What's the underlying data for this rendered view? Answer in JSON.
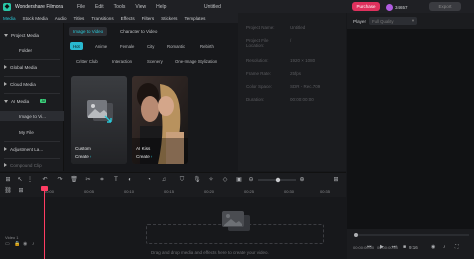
{
  "titlebar": {
    "app_name": "Wondershare Filmora",
    "menu": [
      "File",
      "Edit",
      "Tools",
      "View",
      "Help"
    ],
    "doc_title": "Untitled",
    "purchase_label": "Purchase",
    "coins": "34657",
    "export_label": "Export"
  },
  "toolbar": {
    "tabs": [
      "Media",
      "Stock Media",
      "Audio",
      "Titles",
      "Transitions",
      "Effects",
      "Filters",
      "Stickers",
      "Templates"
    ],
    "active_tab": "Media"
  },
  "sidebar": {
    "items": [
      {
        "label": "Project Media",
        "type": "group",
        "expanded": true
      },
      {
        "label": "Folder",
        "type": "sub"
      },
      {
        "label": "Global Media",
        "type": "group",
        "expanded": false
      },
      {
        "label": "Cloud Media",
        "type": "group",
        "expanded": false
      },
      {
        "label": "AI Media",
        "type": "group",
        "expanded": true,
        "badge": "AI"
      },
      {
        "label": "Image to Vi...",
        "type": "sub",
        "selected": true
      },
      {
        "label": "My File",
        "type": "sub"
      },
      {
        "label": "Adjustment La...",
        "type": "group",
        "expanded": false
      },
      {
        "label": "Compound Clip",
        "type": "group",
        "expanded": false
      }
    ]
  },
  "media": {
    "subtabs": [
      "Image to Video",
      "Character to Video"
    ],
    "chips_row1": [
      "Hot",
      "Anime",
      "Female",
      "City",
      "Romantic",
      "Rebirth"
    ],
    "chips_row2": [
      "Critter Club",
      "Interaction",
      "Scenery",
      "One-Image Stylization"
    ],
    "cards": [
      {
        "title": "Custom",
        "action": "Create"
      },
      {
        "title": "AI Kiss",
        "action": "Create"
      }
    ]
  },
  "properties": {
    "rows": [
      {
        "label": "Project Name:",
        "value": "Untitled"
      },
      {
        "label": "Project File Location:",
        "value": "/"
      },
      {
        "label": "Resolution:",
        "value": "1920 × 1080"
      },
      {
        "label": "Frame Rate:",
        "value": "25fps"
      },
      {
        "label": "Color Space:",
        "value": "SDR - Rec.709"
      },
      {
        "label": "Duration:",
        "value": "00:00:00:00"
      }
    ]
  },
  "player": {
    "title": "Player",
    "quality": "Full Quality",
    "time_current": "00:00:00:00",
    "time_total": "00:00:00:00",
    "aspect": "9:16"
  },
  "timeline": {
    "ticks": [
      "00:00",
      "00:05",
      "00:10",
      "00:15",
      "00:20",
      "00:25",
      "00:30",
      "00:35",
      "00:40",
      "00:45"
    ],
    "track_label": "Video 1",
    "drop_text": "Drag and drop media and effects here to create your video."
  },
  "colors": {
    "accent": "#29c8d8",
    "purchase": "#e0315d",
    "playhead": "#ff3d63",
    "ai_badge": "#3bd27c"
  }
}
